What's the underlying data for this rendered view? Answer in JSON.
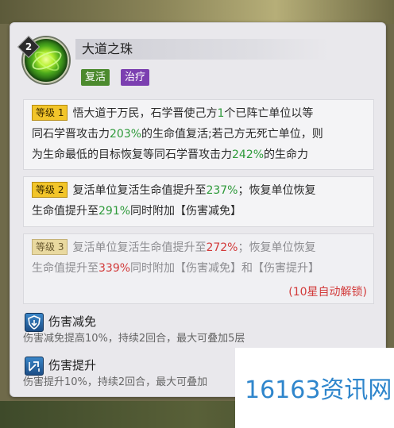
{
  "skill": {
    "level": "2",
    "name": "大道之珠",
    "tags": [
      "复活",
      "治疗"
    ]
  },
  "levels": [
    {
      "badge": "等级 1",
      "lines": [
        [
          "悟大道于万民，石学晋使己方",
          "1",
          "个已阵亡单位以等"
        ],
        [
          "同石学晋攻击力",
          "203%",
          "的生命值复活;若己方无死亡单位，则"
        ],
        [
          "为生命最低的目标恢复等同石学晋攻击力",
          "242%",
          "的生命力"
        ]
      ]
    },
    {
      "badge": "等级 2",
      "lines": [
        [
          "复活单位复活生命值提升至",
          "237%",
          "；恢复单位恢复"
        ],
        [
          "生命值提升至",
          "291%",
          "同时附加【伤害减免】"
        ]
      ]
    },
    {
      "badge": "等级 3",
      "lines": [
        [
          "复活单位复活生命值提升至",
          "272%",
          "；恢复单位恢复"
        ],
        [
          "生命值提升至",
          "339%",
          "同时附加【伤害减免】和【伤害提升】"
        ]
      ],
      "unlock_note": "(10星自动解锁)"
    }
  ],
  "buffs": [
    {
      "name": "伤害减免",
      "desc": "伤害减免提高10%，持续2回合，最大可叠加5层",
      "icon": "shield-down-icon"
    },
    {
      "name": "伤害提升",
      "desc": "伤害提升10%，持续2回合，最大可叠加",
      "icon": "sword-up-icon"
    }
  ],
  "watermark": "16163资讯网",
  "colors": {
    "green": "#2e9a3a",
    "red": "#d23a3a",
    "badge": "#f2c52a",
    "tag_revive": "#4c8a2e",
    "tag_heal": "#7b3fb0"
  }
}
